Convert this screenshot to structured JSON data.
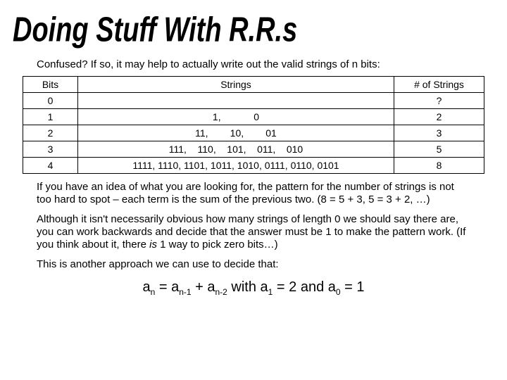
{
  "title": "Doing Stuff With R.R.s",
  "subtitle": "Confused? If so, it may help to actually write out the valid strings of n bits:",
  "headers": {
    "bits": "Bits",
    "strings": "Strings",
    "count": "# of Strings"
  },
  "rows": [
    {
      "bits": "0",
      "strings": "",
      "count": "?"
    },
    {
      "bits": "1",
      "strings": "1,            0",
      "count": "2"
    },
    {
      "bits": "2",
      "strings": "11,        10,        01",
      "count": "3"
    },
    {
      "bits": "3",
      "strings": "111,    110,    101,    011,    010",
      "count": "5"
    },
    {
      "bits": "4",
      "strings": "1111, 1110, 1101, 1011, 1010, 0111, 0110, 0101",
      "count": "8"
    }
  ],
  "para1": "If you have an idea of what you are looking for, the pattern for the number of strings is not too hard to spot – each term is the sum of the previous two. (8 = 5 + 3, 5 = 3 + 2, …)",
  "para2a": "Although it isn't necessarily obvious how many strings of length 0 we should say there are, you can work backwards and decide that the answer must be 1 to make the pattern work. (If you think about it, there ",
  "para2b": "is",
  "para2c": " 1 way to pick zero bits…)",
  "para3": "This is another approach we can use to decide that:",
  "formula": {
    "a": "a",
    "n": "n",
    "eq": " = ",
    "n1": "n-1",
    "plus": " + ",
    "n2": "n-2",
    "with": "  with ",
    "one": "1",
    "eq2": " = 2 and ",
    "zero": "0",
    "eq1": " = 1"
  }
}
